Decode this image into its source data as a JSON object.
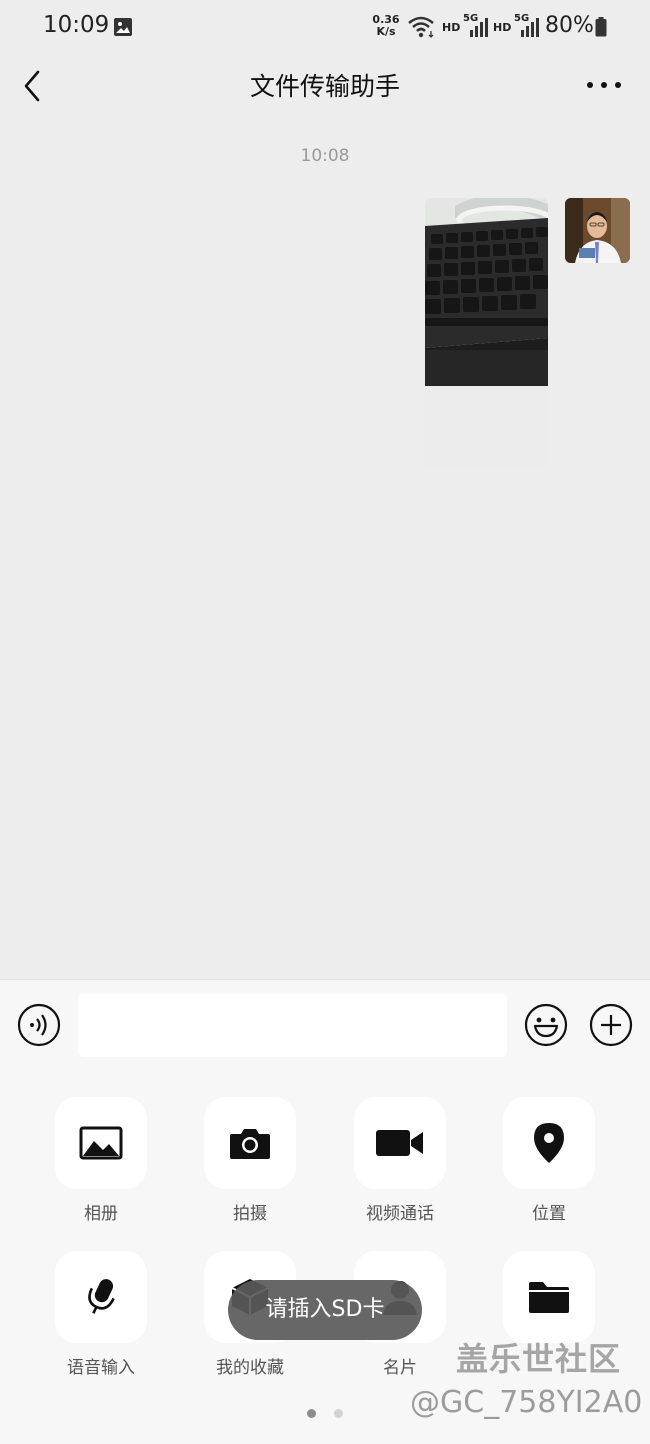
{
  "status_bar": {
    "time": "10:09",
    "net_speed_value": "0.36",
    "net_speed_unit": "K/s",
    "hd_label": "HD",
    "network_label": "5G",
    "battery_percent": "80%"
  },
  "nav": {
    "title": "文件传输助手",
    "back_icon": "chevron-left",
    "more_icon": "ellipsis"
  },
  "chat": {
    "timestamp": "10:08",
    "messages": [
      {
        "type": "image",
        "sender": "me",
        "content": "photo of a keyboard"
      }
    ]
  },
  "input_bar": {
    "voice_icon": "voice",
    "text_value": "",
    "emoji_icon": "smiley",
    "plus_icon": "plus"
  },
  "panel": {
    "row1": [
      {
        "label": "相册",
        "icon": "image"
      },
      {
        "label": "拍摄",
        "icon": "camera"
      },
      {
        "label": "视频通话",
        "icon": "video"
      },
      {
        "label": "位置",
        "icon": "location-pin"
      }
    ],
    "row2": [
      {
        "label": "语音输入",
        "icon": "microphone"
      },
      {
        "label": "我的收藏",
        "icon": "cube"
      },
      {
        "label": "名片",
        "icon": "person"
      },
      {
        "label": "",
        "icon": "folder"
      }
    ],
    "page_count": 2,
    "active_page": 1
  },
  "toast": {
    "text": "请插入SD卡"
  },
  "watermark": {
    "line1": "盖乐世社区",
    "line2": "@GC_758YI2A0"
  },
  "colors": {
    "background": "#ededed",
    "panel": "#f7f7f7",
    "icon": "#111111",
    "toast": "#5a5a5a",
    "dot_active": "#8c8c8c",
    "dot_inactive": "#d2d2d2"
  }
}
